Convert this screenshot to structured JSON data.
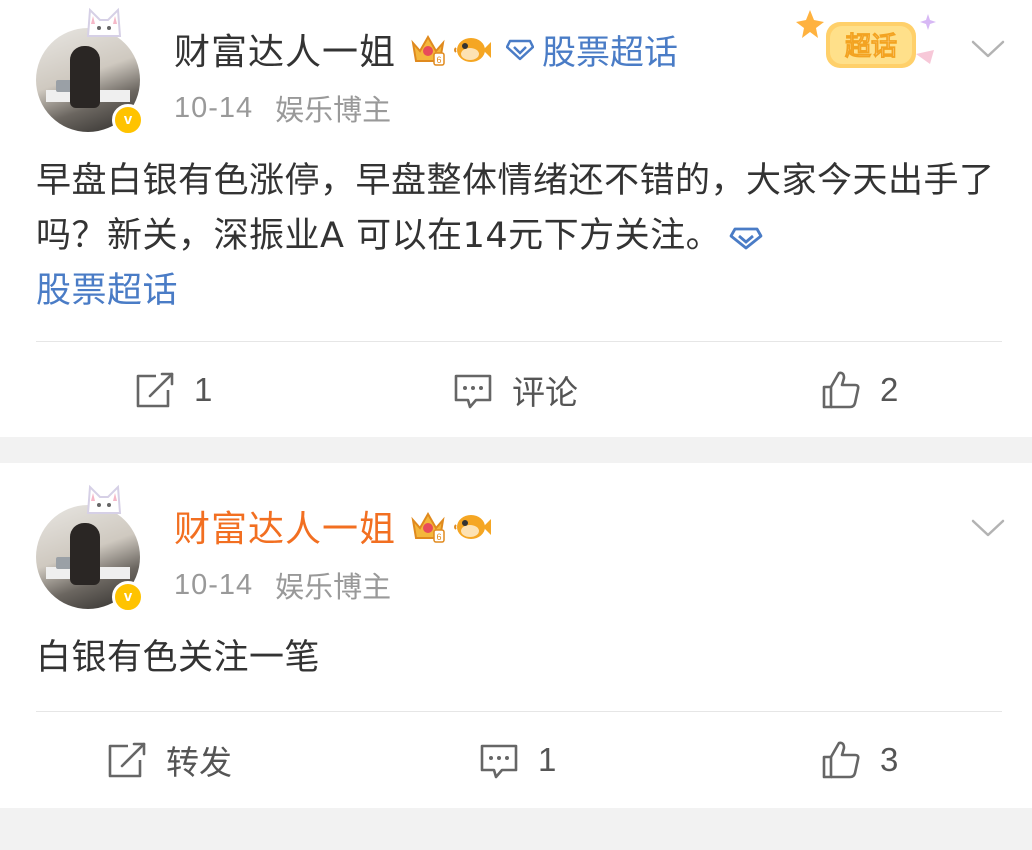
{
  "posts": [
    {
      "username": "财富达人一姐",
      "topic_label": "股票超话",
      "date": "10-14",
      "role": "娱乐博主",
      "badge_text": "超话",
      "verified_mark": "v",
      "content": "早盘白银有色涨停，早盘整体情绪还不错的，大家今天出手了吗？新关，深振业A 可以在14元下方关注。",
      "content_topic": "股票超话",
      "actions": {
        "repost": "1",
        "comment": "评论",
        "like": "2"
      }
    },
    {
      "username": "财富达人一姐",
      "date": "10-14",
      "role": "娱乐博主",
      "verified_mark": "v",
      "content": "白银有色关注一笔",
      "actions": {
        "repost": "转发",
        "comment": "1",
        "like": "3"
      }
    }
  ],
  "icons": {
    "more": "chevron-down-icon",
    "repost": "repost-icon",
    "comment": "comment-icon",
    "like": "thumbs-up-icon",
    "topic": "diamond-icon",
    "vip": "crown-icon",
    "fan": "puffer-fish-icon"
  },
  "colors": {
    "username_default": "#333333",
    "username_highlight": "#f26f21",
    "topic_link": "#4a7cc6",
    "verified_badge": "#ffc300",
    "meta_text": "#999999"
  }
}
